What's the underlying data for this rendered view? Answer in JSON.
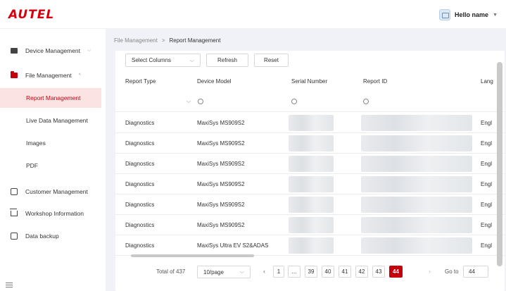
{
  "brand": {
    "logo": "AUTEL",
    "accent": "#c4000f"
  },
  "user": {
    "name": "Hello name",
    "avatar_icon": "user-card-icon"
  },
  "sidebar": {
    "items": [
      {
        "label": "Device Management",
        "icon": "device-icon"
      },
      {
        "label": "File Management",
        "icon": "folder-icon"
      },
      {
        "label": "Customer Management",
        "icon": "customer-icon"
      },
      {
        "label": "Workshop Information",
        "icon": "workshop-icon"
      },
      {
        "label": "Data backup",
        "icon": "backup-icon"
      }
    ],
    "sub_items": [
      {
        "label": "Report Management",
        "active": true
      },
      {
        "label": "Live Data Management"
      },
      {
        "label": "Images"
      },
      {
        "label": "PDF"
      }
    ]
  },
  "breadcrumb": {
    "parent": "File Management",
    "separator": ">",
    "current": "Report Management"
  },
  "toolbar": {
    "select_columns": "Select Columns",
    "refresh": "Refresh",
    "reset": "Reset"
  },
  "table": {
    "columns": [
      "Report Type",
      "Device Model",
      "Serial Number",
      "Report ID",
      "Lang"
    ],
    "rows": [
      {
        "type": "Diagnostics",
        "model": "MaxiSys MS909S2",
        "lang": "Engl"
      },
      {
        "type": "Diagnostics",
        "model": "MaxiSys MS909S2",
        "lang": "Engl"
      },
      {
        "type": "Diagnostics",
        "model": "MaxiSys MS909S2",
        "lang": "Engl"
      },
      {
        "type": "Diagnostics",
        "model": "MaxiSys MS909S2",
        "lang": "Engl"
      },
      {
        "type": "Diagnostics",
        "model": "MaxiSys MS909S2",
        "lang": "Engl"
      },
      {
        "type": "Diagnostics",
        "model": "MaxiSys MS909S2",
        "lang": "Engl"
      },
      {
        "type": "Diagnostics",
        "model": "MaxiSys Ultra EV S2&ADAS",
        "lang": "Engl"
      }
    ]
  },
  "pagination": {
    "total": "Total of 437",
    "page_size": "10/page",
    "pages": [
      "1",
      "...",
      "39",
      "40",
      "41",
      "42",
      "43",
      "44"
    ],
    "current": "44",
    "goto_label": "Go to",
    "goto_value": "44"
  }
}
